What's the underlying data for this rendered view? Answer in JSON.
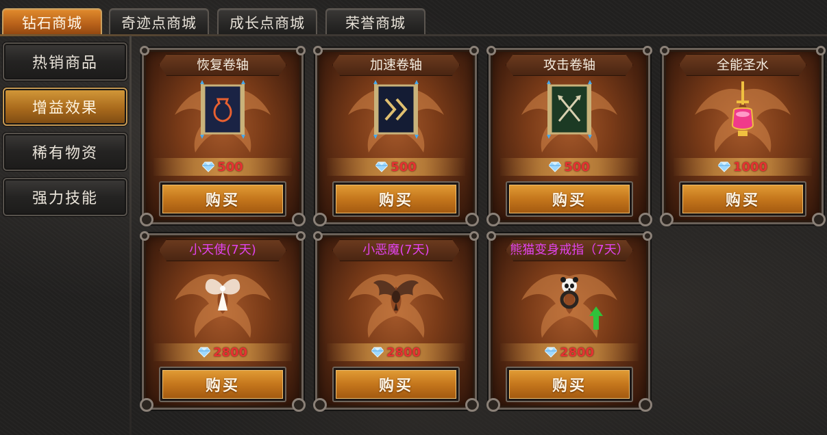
{
  "tabs": [
    {
      "label": "钻石商城",
      "active": true
    },
    {
      "label": "奇迹点商城",
      "active": false
    },
    {
      "label": "成长点商城",
      "active": false
    },
    {
      "label": "荣誉商城",
      "active": false
    }
  ],
  "sidebar": {
    "items": [
      {
        "label": "热销商品",
        "active": false
      },
      {
        "label": "增益效果",
        "active": true
      },
      {
        "label": "稀有物资",
        "active": false
      },
      {
        "label": "强力技能",
        "active": false
      }
    ]
  },
  "items": [
    {
      "name": "恢复卷轴",
      "price": "500",
      "buy_label": "购买",
      "icon": "potion-scroll-icon",
      "name_color": "#f5ede0"
    },
    {
      "name": "加速卷轴",
      "price": "500",
      "buy_label": "购买",
      "icon": "speed-scroll-icon",
      "name_color": "#f5ede0"
    },
    {
      "name": "攻击卷轴",
      "price": "500",
      "buy_label": "购买",
      "icon": "attack-scroll-icon",
      "name_color": "#f5ede0"
    },
    {
      "name": "全能圣水",
      "price": "1000",
      "buy_label": "购买",
      "icon": "holy-water-icon",
      "name_color": "#f5ede0"
    },
    {
      "name": "小天使(7天)",
      "price": "2800",
      "buy_label": "购买",
      "icon": "angel-icon",
      "name_color": "#e243ee"
    },
    {
      "name": "小恶魔(7天)",
      "price": "2800",
      "buy_label": "购买",
      "icon": "demon-icon",
      "name_color": "#e243ee"
    },
    {
      "name": "熊猫变身戒指（7天）",
      "price": "2800",
      "buy_label": "购买",
      "icon": "panda-ring-icon",
      "name_color": "#e243ee"
    }
  ],
  "colors": {
    "price": "#e43232",
    "active_tab": "#c96f20",
    "limited_title": "#e243ee"
  }
}
